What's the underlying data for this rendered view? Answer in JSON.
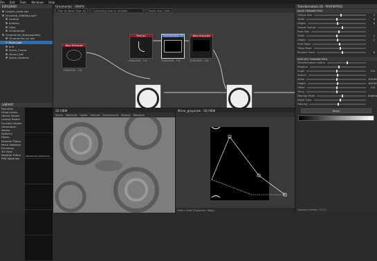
{
  "menubar": [
    "File",
    "Edit",
    "Tools",
    "Windows",
    "Help"
  ],
  "explorer": {
    "title": "EXPLORER",
    "items": [
      {
        "label": "custom_fonts.sbs",
        "sel": false
      },
      {
        "label": "Graveled_1960Sbs.sbs*",
        "sel": false
      },
      {
        "label": "Leather",
        "sel": false
      },
      {
        "label": "Knitting",
        "sel": false
      },
      {
        "label": "Iutes",
        "sel": false
      },
      {
        "label": "Ornamental",
        "sel": false
      },
      {
        "label": "Ornamental_Brasswoodslo",
        "sel": false
      },
      {
        "label": "Ornamental_ori.sbs",
        "sel": false
      },
      {
        "label": "floral_ball",
        "sel": true
      },
      {
        "label": "knit",
        "sel": false
      },
      {
        "label": "Spiral_Coarse",
        "sel": false
      },
      {
        "label": "simple_ball",
        "sel": false
      },
      {
        "label": "Spiral_middlew",
        "sel": false
      }
    ]
  },
  "library": {
    "title": "LIBRARY",
    "categories": [
      "Favorites",
      "Graph Items",
      "Atomic Nodes",
      "Lookup Nodes",
      "Function Nodes",
      "Generators",
      "Noises",
      "Patterns",
      "Filters",
      "Material Filters",
      "Mesh Adaptive",
      "Functions",
      "3D View",
      "Material Filters",
      "PBR Materials"
    ],
    "thumbs": [
      "",
      "abandoned_warehouse",
      "",
      "",
      "",
      ""
    ]
  },
  "graph": {
    "tab": "Ornamental - GRAPH",
    "filter_label": "Filter by Node Type: All",
    "search_placeholder": "Containing (sub) or variable",
    "param_label": "Parent Size: 2048",
    "node_labels": [
      "Warp Grayscale",
      "Pixel_brl",
      "Transformation 2D",
      "Warp Grayscale",
      "2048x2048 - 116",
      "2048x2048 - 116",
      "2048x2048 - 116",
      "2048x2048 - 116"
    ]
  },
  "view2d": {
    "tab": "2D VIEW",
    "status": "2048 x 2048 (Grayscale, 16bpc)",
    "menu": [
      "Scene",
      "Materials",
      "Lights",
      "Camera",
      "Environment",
      "Display",
      "Renderer"
    ]
  },
  "view3d": {
    "tab": "Mirror_grayscale - 2D VIEW"
  },
  "props": {
    "title": "Transformation 2D - PROPERTIES",
    "sections": [
      "BASE PARAMETERS",
      "SPECIFIC PARAMETERS"
    ],
    "base": [
      {
        "label": "Output Size",
        "value": "2"
      },
      {
        "label": "Width",
        "value": "0"
      },
      {
        "label": "Height",
        "value": "0"
      },
      {
        "label": "Output Format",
        "value": ""
      },
      {
        "label": "Pixel Size",
        "value": ""
      },
      {
        "label": "Width",
        "value": "1"
      },
      {
        "label": "Height",
        "value": "1"
      },
      {
        "label": "Pixel Ratio",
        "value": ""
      },
      {
        "label": "Tiling Mode",
        "value": ""
      },
      {
        "label": "Random Seed",
        "value": "0"
      }
    ],
    "specific": [
      {
        "label": "Transformation matrix",
        "value": ""
      },
      {
        "label": "Rotation",
        "value": ""
      },
      {
        "label": "Angle",
        "value": "0.0"
      },
      {
        "label": "Stretch",
        "value": ""
      },
      {
        "label": "Width",
        "value": "100.00%"
      },
      {
        "label": "Height",
        "value": "100.00%"
      },
      {
        "label": "Offset",
        "value": "0.0"
      },
      {
        "label": "Tiling",
        "value": ""
      },
      {
        "label": "Mipmap Mode",
        "value": "Automatic"
      },
      {
        "label": "Matte Color",
        "value": ""
      },
      {
        "label": "Filtering",
        "value": ""
      }
    ],
    "reset": "Reset",
    "footer": "Substance Version: 10.1.1"
  }
}
